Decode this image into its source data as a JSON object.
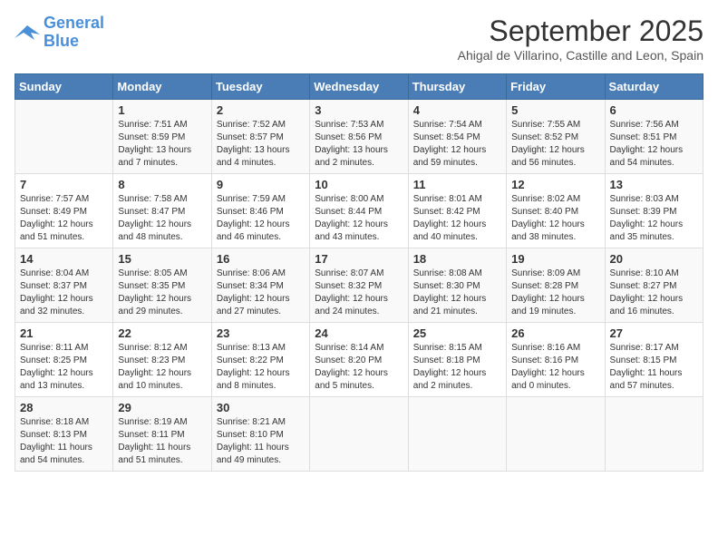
{
  "logo": {
    "line1": "General",
    "line2": "Blue"
  },
  "title": "September 2025",
  "location": "Ahigal de Villarino, Castille and Leon, Spain",
  "headers": [
    "Sunday",
    "Monday",
    "Tuesday",
    "Wednesday",
    "Thursday",
    "Friday",
    "Saturday"
  ],
  "weeks": [
    [
      {
        "day": "",
        "info": ""
      },
      {
        "day": "1",
        "info": "Sunrise: 7:51 AM\nSunset: 8:59 PM\nDaylight: 13 hours\nand 7 minutes."
      },
      {
        "day": "2",
        "info": "Sunrise: 7:52 AM\nSunset: 8:57 PM\nDaylight: 13 hours\nand 4 minutes."
      },
      {
        "day": "3",
        "info": "Sunrise: 7:53 AM\nSunset: 8:56 PM\nDaylight: 13 hours\nand 2 minutes."
      },
      {
        "day": "4",
        "info": "Sunrise: 7:54 AM\nSunset: 8:54 PM\nDaylight: 12 hours\nand 59 minutes."
      },
      {
        "day": "5",
        "info": "Sunrise: 7:55 AM\nSunset: 8:52 PM\nDaylight: 12 hours\nand 56 minutes."
      },
      {
        "day": "6",
        "info": "Sunrise: 7:56 AM\nSunset: 8:51 PM\nDaylight: 12 hours\nand 54 minutes."
      }
    ],
    [
      {
        "day": "7",
        "info": "Sunrise: 7:57 AM\nSunset: 8:49 PM\nDaylight: 12 hours\nand 51 minutes."
      },
      {
        "day": "8",
        "info": "Sunrise: 7:58 AM\nSunset: 8:47 PM\nDaylight: 12 hours\nand 48 minutes."
      },
      {
        "day": "9",
        "info": "Sunrise: 7:59 AM\nSunset: 8:46 PM\nDaylight: 12 hours\nand 46 minutes."
      },
      {
        "day": "10",
        "info": "Sunrise: 8:00 AM\nSunset: 8:44 PM\nDaylight: 12 hours\nand 43 minutes."
      },
      {
        "day": "11",
        "info": "Sunrise: 8:01 AM\nSunset: 8:42 PM\nDaylight: 12 hours\nand 40 minutes."
      },
      {
        "day": "12",
        "info": "Sunrise: 8:02 AM\nSunset: 8:40 PM\nDaylight: 12 hours\nand 38 minutes."
      },
      {
        "day": "13",
        "info": "Sunrise: 8:03 AM\nSunset: 8:39 PM\nDaylight: 12 hours\nand 35 minutes."
      }
    ],
    [
      {
        "day": "14",
        "info": "Sunrise: 8:04 AM\nSunset: 8:37 PM\nDaylight: 12 hours\nand 32 minutes."
      },
      {
        "day": "15",
        "info": "Sunrise: 8:05 AM\nSunset: 8:35 PM\nDaylight: 12 hours\nand 29 minutes."
      },
      {
        "day": "16",
        "info": "Sunrise: 8:06 AM\nSunset: 8:34 PM\nDaylight: 12 hours\nand 27 minutes."
      },
      {
        "day": "17",
        "info": "Sunrise: 8:07 AM\nSunset: 8:32 PM\nDaylight: 12 hours\nand 24 minutes."
      },
      {
        "day": "18",
        "info": "Sunrise: 8:08 AM\nSunset: 8:30 PM\nDaylight: 12 hours\nand 21 minutes."
      },
      {
        "day": "19",
        "info": "Sunrise: 8:09 AM\nSunset: 8:28 PM\nDaylight: 12 hours\nand 19 minutes."
      },
      {
        "day": "20",
        "info": "Sunrise: 8:10 AM\nSunset: 8:27 PM\nDaylight: 12 hours\nand 16 minutes."
      }
    ],
    [
      {
        "day": "21",
        "info": "Sunrise: 8:11 AM\nSunset: 8:25 PM\nDaylight: 12 hours\nand 13 minutes."
      },
      {
        "day": "22",
        "info": "Sunrise: 8:12 AM\nSunset: 8:23 PM\nDaylight: 12 hours\nand 10 minutes."
      },
      {
        "day": "23",
        "info": "Sunrise: 8:13 AM\nSunset: 8:22 PM\nDaylight: 12 hours\nand 8 minutes."
      },
      {
        "day": "24",
        "info": "Sunrise: 8:14 AM\nSunset: 8:20 PM\nDaylight: 12 hours\nand 5 minutes."
      },
      {
        "day": "25",
        "info": "Sunrise: 8:15 AM\nSunset: 8:18 PM\nDaylight: 12 hours\nand 2 minutes."
      },
      {
        "day": "26",
        "info": "Sunrise: 8:16 AM\nSunset: 8:16 PM\nDaylight: 12 hours\nand 0 minutes."
      },
      {
        "day": "27",
        "info": "Sunrise: 8:17 AM\nSunset: 8:15 PM\nDaylight: 11 hours\nand 57 minutes."
      }
    ],
    [
      {
        "day": "28",
        "info": "Sunrise: 8:18 AM\nSunset: 8:13 PM\nDaylight: 11 hours\nand 54 minutes."
      },
      {
        "day": "29",
        "info": "Sunrise: 8:19 AM\nSunset: 8:11 PM\nDaylight: 11 hours\nand 51 minutes."
      },
      {
        "day": "30",
        "info": "Sunrise: 8:21 AM\nSunset: 8:10 PM\nDaylight: 11 hours\nand 49 minutes."
      },
      {
        "day": "",
        "info": ""
      },
      {
        "day": "",
        "info": ""
      },
      {
        "day": "",
        "info": ""
      },
      {
        "day": "",
        "info": ""
      }
    ]
  ]
}
